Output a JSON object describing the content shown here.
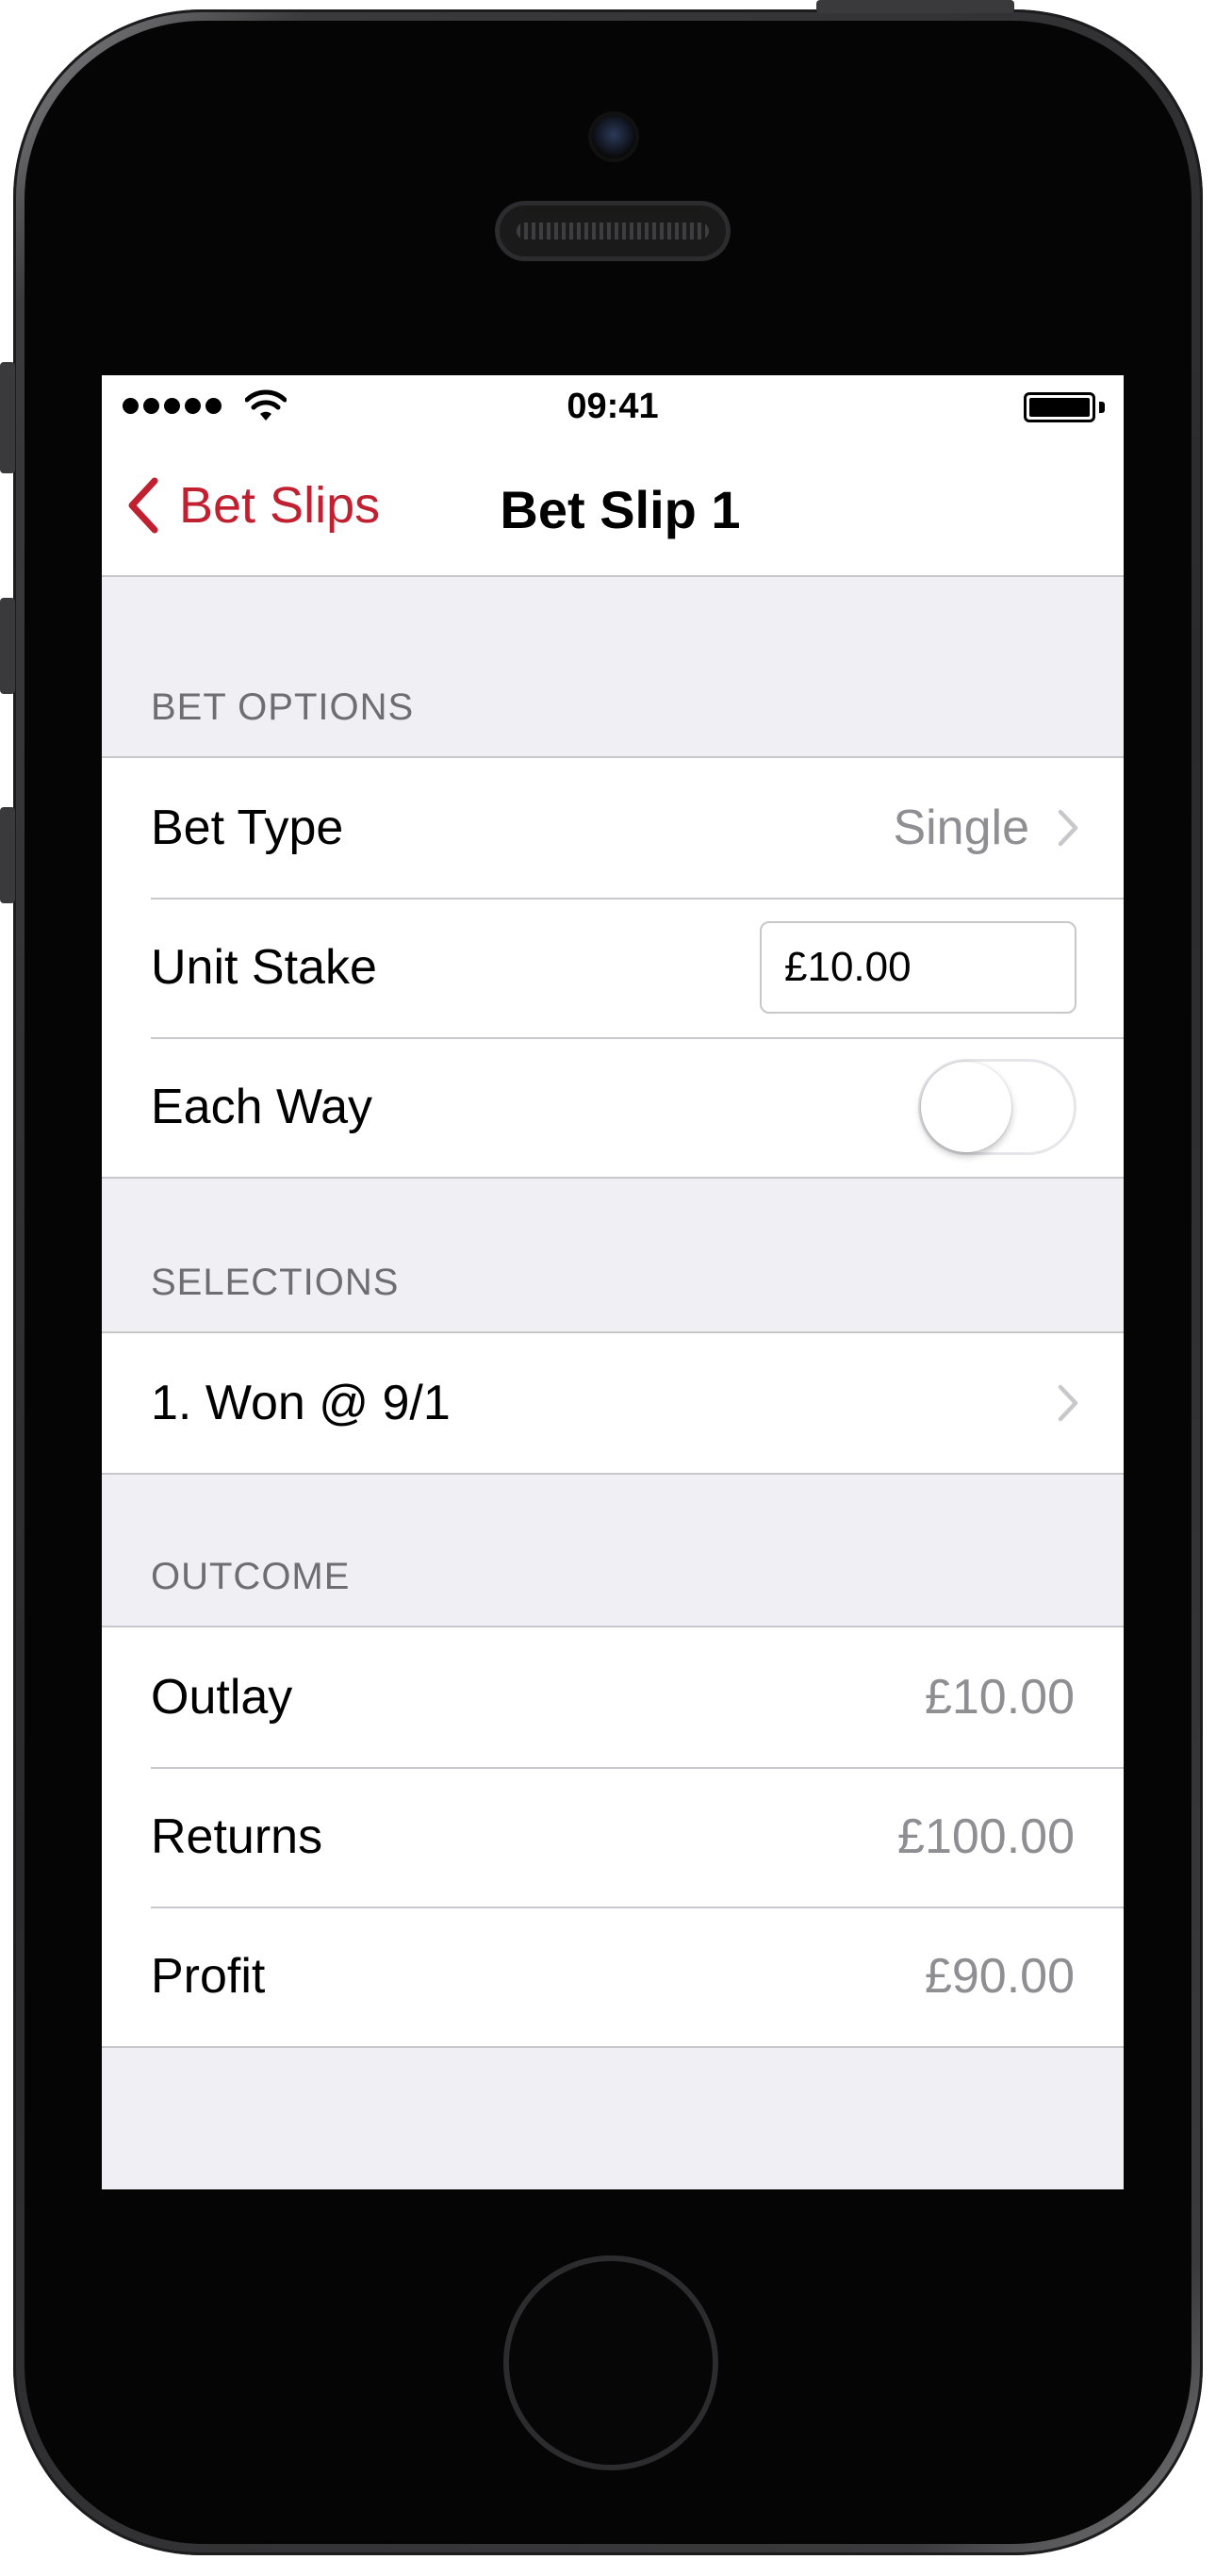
{
  "status_bar": {
    "time": "09:41",
    "signal_icon": "signal-dots-icon",
    "wifi_icon": "wifi-icon",
    "battery_icon": "battery-icon"
  },
  "nav": {
    "back_label": "Bet Slips",
    "title": "Bet Slip 1",
    "accent_color": "#c0202f"
  },
  "bet_options": {
    "header": "BET OPTIONS",
    "bet_type_label": "Bet Type",
    "bet_type_value": "Single",
    "unit_stake_label": "Unit Stake",
    "unit_stake_value": "£10.00",
    "each_way_label": "Each Way",
    "each_way_on": false
  },
  "selections": {
    "header": "SELECTIONS",
    "items": [
      {
        "label": "1. Won @ 9/1"
      }
    ]
  },
  "outcome": {
    "header": "OUTCOME",
    "outlay_label": "Outlay",
    "outlay_value": "£10.00",
    "returns_label": "Returns",
    "returns_value": "£100.00",
    "profit_label": "Profit",
    "profit_value": "£90.00"
  }
}
